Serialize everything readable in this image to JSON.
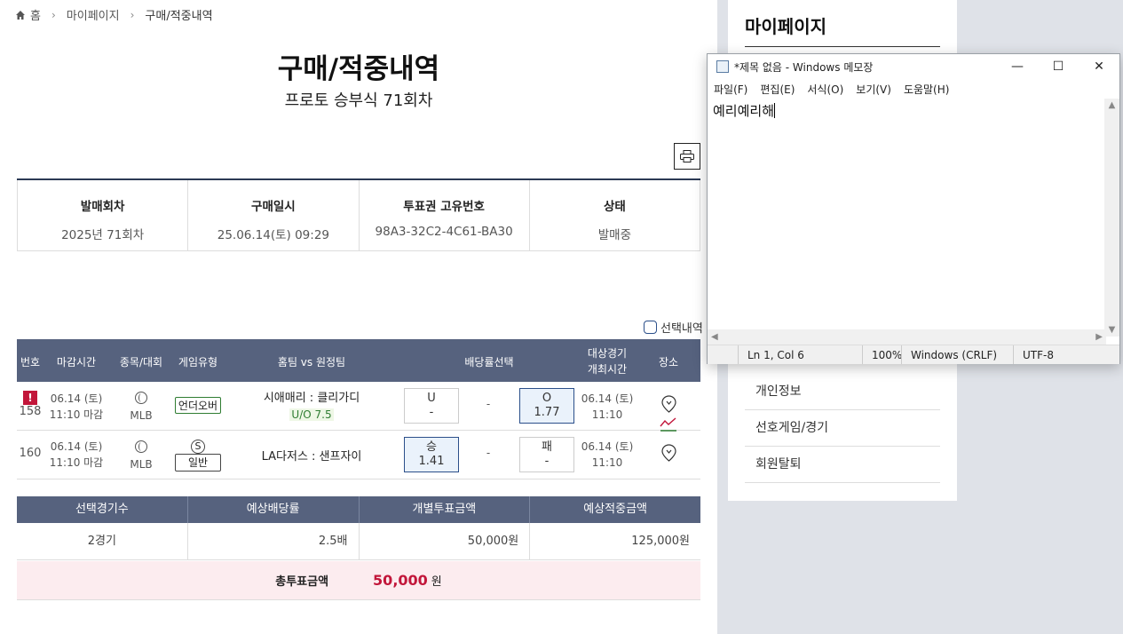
{
  "breadcrumb": {
    "home": "홈",
    "mypage": "마이페이지",
    "current": "구매/적중내역"
  },
  "page": {
    "title": "구매/적중내역",
    "subtitle": "프로토 승부식 71회차"
  },
  "info": [
    {
      "label": "발매회차",
      "value": "2025년 71회차"
    },
    {
      "label": "구매일시",
      "value": "25.06.14(토) 09:29"
    },
    {
      "label": "투표권 고유번호",
      "value": "98A3-32C2-4C61-BA30"
    },
    {
      "label": "상태",
      "value": "발매중"
    }
  ],
  "select_toggle": "선택내역",
  "games_header": {
    "no": "번호",
    "deadline": "마감시간",
    "sport": "종목/대회",
    "type": "게임유형",
    "teams": "홈팀 vs 원정팀",
    "odds": "배당률선택",
    "game_time_1": "대상경기",
    "game_time_2": "개최시간",
    "venue": "장소"
  },
  "games": [
    {
      "warn": "!",
      "no": "158",
      "date": "06.14 (토)",
      "time": "11:10 마감",
      "league": "MLB",
      "type": "언더오버",
      "teams": "시애매리 : 클리가디",
      "sub": "U/O 7.5",
      "odd1_label": "U",
      "odd1_value": "-",
      "mid": "-",
      "odd2_label": "O",
      "odd2_value": "1.77",
      "game_date": "06.14 (토)",
      "game_time": "11:10"
    },
    {
      "no": "160",
      "date": "06.14 (토)",
      "time": "11:10 마감",
      "league": "MLB",
      "type_s": "S",
      "type": "일반",
      "teams": "LA다저스 : 샌프자이",
      "odd1_label": "승",
      "odd1_value": "1.41",
      "mid": "-",
      "odd2_label": "패",
      "odd2_value": "-",
      "game_date": "06.14 (토)",
      "game_time": "11:10"
    }
  ],
  "summary": {
    "headers": [
      "선택경기수",
      "예상배당률",
      "개별투표금액",
      "예상적중금액"
    ],
    "values": [
      "2경기",
      "2.5배",
      "50,000원",
      "125,000원"
    ],
    "total_label": "총투표금액",
    "total_amount": "50,000",
    "total_unit": "원"
  },
  "side": {
    "title": "마이페이지",
    "items": [
      "개인정보",
      "선호게임/경기",
      "회원탈퇴"
    ]
  },
  "notepad": {
    "title": "*제목 없음 - Windows 메모장",
    "menu": [
      "파일(F)",
      "편집(E)",
      "서식(O)",
      "보기(V)",
      "도움말(H)"
    ],
    "content": "예리예리해",
    "status": {
      "pos": "Ln 1, Col 6",
      "zoom": "100%",
      "eol": "Windows (CRLF)",
      "enc": "UTF-8"
    }
  }
}
